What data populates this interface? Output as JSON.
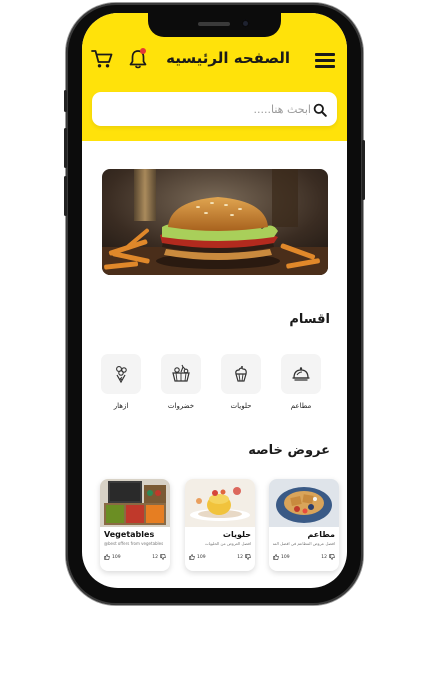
{
  "header": {
    "title": "الصفحه الرئيسيه",
    "search_placeholder": "ابحث هنا.....",
    "accent_color": "#ffe20a",
    "notification_dot_color": "#e53935",
    "icons": [
      "menu-icon",
      "bell-icon",
      "cart-icon",
      "search-icon"
    ]
  },
  "categories": {
    "title": "اقسام",
    "items": [
      {
        "label": "مطاعم",
        "icon": "restaurant-cloche-icon"
      },
      {
        "label": "حلويات",
        "icon": "cupcake-icon"
      },
      {
        "label": "خضروات",
        "icon": "vegetable-basket-icon"
      },
      {
        "label": "ازهار",
        "icon": "flowers-icon"
      }
    ]
  },
  "offers": {
    "title": "عروض خاصه",
    "cards": [
      {
        "title": "مطاعم",
        "subtitle": "افضل عروض المطاعم في افضل المطاعم",
        "likes": "109",
        "dislikes": "12"
      },
      {
        "title": "حلويات",
        "subtitle": "افضل العروض من الحلويات",
        "likes": "109",
        "dislikes": "12"
      },
      {
        "title": "Vegetables",
        "subtitle": "@best offers from vegetables",
        "likes": "109",
        "dislikes": "12"
      }
    ]
  }
}
